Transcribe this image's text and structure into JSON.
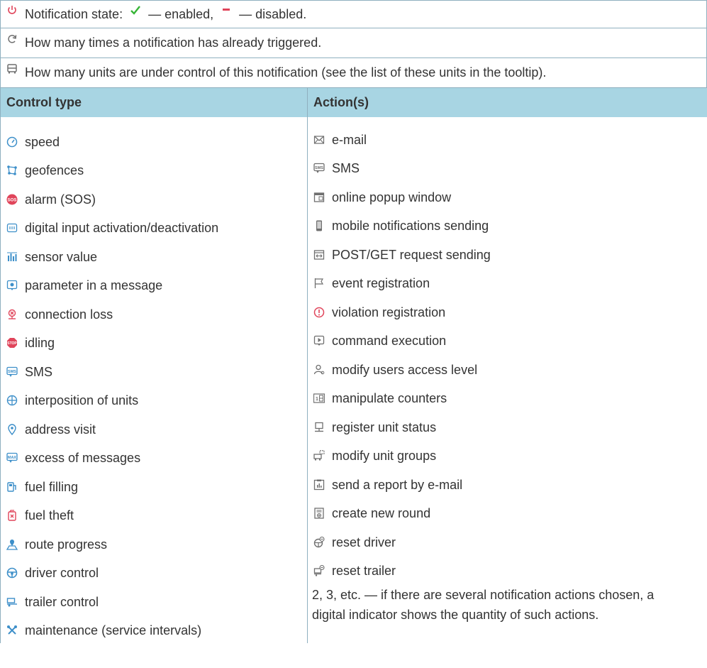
{
  "legend": {
    "state": {
      "prefix": "Notification state:",
      "enabled": "— enabled,",
      "disabled": "— disabled.",
      "icon": "power-icon"
    },
    "triggered": {
      "text": "How many times a notification has already triggered.",
      "icon": "refresh-icon"
    },
    "units": {
      "text": "How many units are under control of this notification (see the list of these units in the tooltip).",
      "icon": "bus-icon"
    }
  },
  "table": {
    "col_control": "Control type",
    "col_actions": "Action(s)",
    "control_types": [
      {
        "label": "speed",
        "icon": "speedometer-icon"
      },
      {
        "label": "geofences",
        "icon": "geofence-icon"
      },
      {
        "label": "alarm (SOS)",
        "icon": "sos-icon"
      },
      {
        "label": "digital input activation/deactivation",
        "icon": "digital-input-icon"
      },
      {
        "label": "sensor value",
        "icon": "sensor-icon"
      },
      {
        "label": "parameter in a message",
        "icon": "parameter-icon"
      },
      {
        "label": "connection loss",
        "icon": "connection-loss-icon"
      },
      {
        "label": "idling",
        "icon": "stop-icon"
      },
      {
        "label": "SMS",
        "icon": "sms-icon"
      },
      {
        "label": "interposition of units",
        "icon": "interposition-icon"
      },
      {
        "label": "address visit",
        "icon": "map-pin-icon"
      },
      {
        "label": "excess of messages",
        "icon": "max-messages-icon"
      },
      {
        "label": "fuel filling",
        "icon": "fuel-filling-icon"
      },
      {
        "label": "fuel theft",
        "icon": "fuel-theft-icon"
      },
      {
        "label": "route progress",
        "icon": "route-icon"
      },
      {
        "label": "driver control",
        "icon": "steering-wheel-icon"
      },
      {
        "label": "trailer control",
        "icon": "trailer-icon"
      },
      {
        "label": "maintenance (service intervals)",
        "icon": "wrench-icon"
      }
    ],
    "actions": [
      {
        "label": "e-mail",
        "icon": "envelope-icon"
      },
      {
        "label": "SMS",
        "icon": "sms-icon"
      },
      {
        "label": "online popup window",
        "icon": "popup-window-icon"
      },
      {
        "label": "mobile notifications sending",
        "icon": "mobile-icon"
      },
      {
        "label": "POST/GET request sending",
        "icon": "request-icon"
      },
      {
        "label": "event registration",
        "icon": "flag-icon"
      },
      {
        "label": "violation registration",
        "icon": "warning-icon"
      },
      {
        "label": "command execution",
        "icon": "command-icon"
      },
      {
        "label": "modify users access level",
        "icon": "user-icon"
      },
      {
        "label": "manipulate counters",
        "icon": "counter-icon"
      },
      {
        "label": "register unit status",
        "icon": "unit-status-icon"
      },
      {
        "label": "modify unit groups",
        "icon": "unit-groups-icon"
      },
      {
        "label": "send a report by e-mail",
        "icon": "report-icon"
      },
      {
        "label": "create new round",
        "icon": "new-round-icon"
      },
      {
        "label": "reset driver",
        "icon": "reset-driver-icon"
      },
      {
        "label": "reset trailer",
        "icon": "reset-trailer-icon"
      }
    ],
    "note": "2, 3, etc. — if there are several notification actions chosen, a digital indicator shows the quantity of such actions."
  },
  "colors": {
    "header_bg": "#a8d5e3",
    "border": "#8fb0bf",
    "icon_blue": "#3d8fc9",
    "icon_red": "#e0445a",
    "icon_green": "#36b536",
    "icon_gray": "#6f6f6f"
  }
}
